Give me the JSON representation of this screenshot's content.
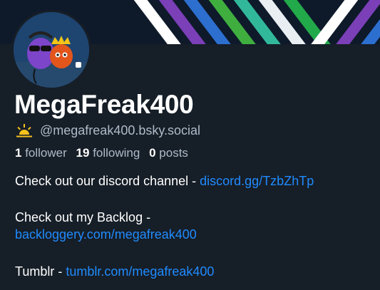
{
  "profile": {
    "display_name": "MegaFreak400",
    "handle": "@megafreak400.bsky.social",
    "handle_emoji_icon": "sun-icon",
    "stats": {
      "followers_count": "1",
      "followers_label": "follower",
      "following_count": "19",
      "following_label": "following",
      "posts_count": "0",
      "posts_label": "posts"
    },
    "bio": {
      "line1_text": "Check out our discord channel - ",
      "line1_link": "discord.gg/TzbZhTp",
      "line2_text": "Check out my Backlog -",
      "line2_link": "backloggery.com/megafreak400",
      "line3_text": "Tumblr - ",
      "line3_link": "tumblr.com/megafreak400"
    }
  },
  "colors": {
    "background": "#161e27",
    "text_primary": "#ffffff",
    "text_secondary": "#aebbc9",
    "link": "#208bfe"
  }
}
